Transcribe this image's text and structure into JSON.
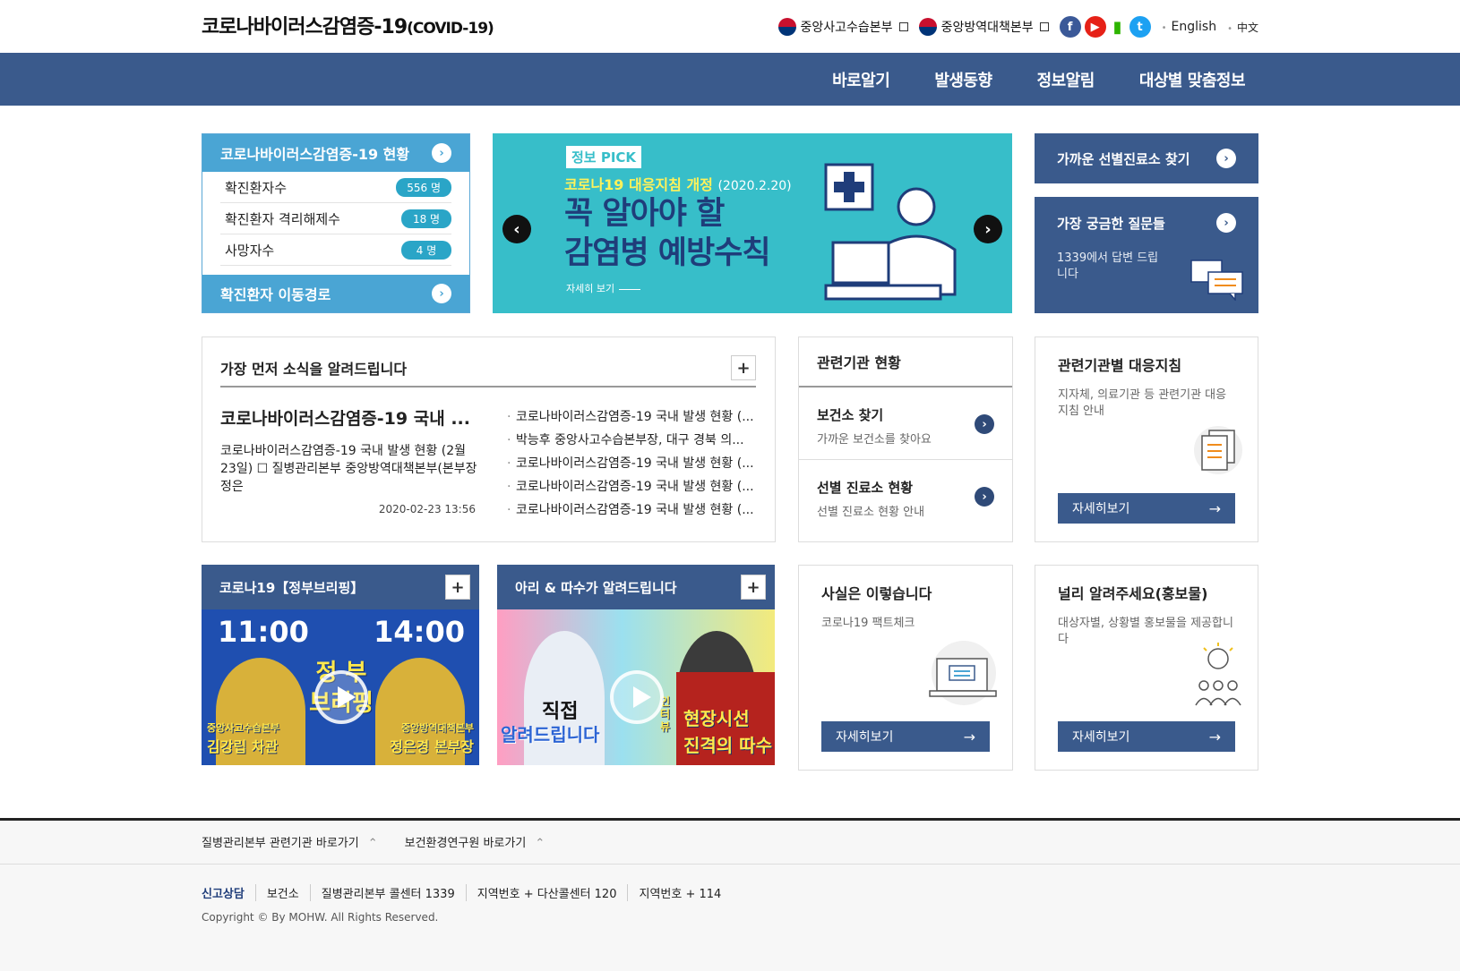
{
  "header": {
    "title_main": "코로나바이러스감염증-19",
    "title_sub": "(COVID-19)",
    "gov_links": [
      "중앙사고수습본부",
      "중앙방역대책본부"
    ],
    "sns": [
      "facebook-icon",
      "youtube-icon",
      "blog-icon",
      "twitter-icon"
    ],
    "languages": [
      "English",
      "中文"
    ]
  },
  "nav": {
    "items": [
      "바로알기",
      "발생동향",
      "정보알림",
      "대상별 맞춤정보"
    ]
  },
  "status": {
    "title": "코로나바이러스감염증-19 현황",
    "rows": [
      {
        "label": "확진환자수",
        "value": "556 명"
      },
      {
        "label": "확진환자 격리해제수",
        "value": "18 명"
      },
      {
        "label": "사망자수",
        "value": "4 명"
      }
    ],
    "route": "확진환자 이동경로"
  },
  "banner": {
    "tag": "정보 PICK",
    "sub": "코로나19 대응지침 개정",
    "date": "(2020.2.20)",
    "title_line1": "꼭 알아야 할",
    "title_line2": "감염병 예방수칙",
    "more": "자세히 보기",
    "prev": "‹",
    "next": "›"
  },
  "clinic": {
    "title": "가까운 선별진료소 찾기"
  },
  "faq": {
    "title": "가장 궁금한 질문들",
    "desc": "1339에서 답변 드립니다"
  },
  "news": {
    "title": "가장 먼저 소식을 알려드립니다",
    "main_title": "코로나바이러스감염증-19 국내 ...",
    "main_body": "코로나바이러스감염증-19 국내 발생 현황 (2월 23일) ☐ 질병관리본부 중앙방역대책본부(본부장 정은",
    "date": "2020-02-23 13:56",
    "list": [
      "코로나바이러스감염증-19 국내 발생 현황 (...",
      "박능후 중앙사고수습본부장, 대구 경북 의...",
      "코로나바이러스감염증-19 국내 발생 현황 (...",
      "코로나바이러스감염증-19 국내 발생 현황 (...",
      "코로나바이러스감염증-19 국내 발생 현황 (..."
    ]
  },
  "agency": {
    "title": "관련기관 현황",
    "rows": [
      {
        "title": "보건소 찾기",
        "desc": "가까운 보건소를 찾아요"
      },
      {
        "title": "선별 진료소 현황",
        "desc": "선별 진료소 현황 안내"
      }
    ]
  },
  "guide": {
    "title": "관련기관별 대응지침",
    "desc": "지자체, 의료기관 등 관련기관 대응 지침 안내",
    "btn": "자세히보기"
  },
  "brief": {
    "title": "코로나19【정부브리핑】",
    "time_left": "11:00",
    "time_right": "14:00",
    "center_text": "정 부 브리핑",
    "left_org": "중앙사고수습본부",
    "left_name": "김강립 차관",
    "right_org": "중앙방역대책본부",
    "right_name": "정은경 본부장"
  },
  "ari": {
    "title": "아리 & 따수가 알려드립니다",
    "left_text1": "직접",
    "left_text2": "알려드립니다",
    "right_text1": "현장시선",
    "right_text2": "진격의 따수",
    "right_tag": "인터뷰"
  },
  "fact": {
    "title": "사실은 이렇습니다",
    "desc": "코로나19 팩트체크",
    "btn": "자세히보기"
  },
  "promo": {
    "title": "널리 알려주세요(홍보물)",
    "desc": "대상자별, 상황별 홍보물을 제공합니다",
    "btn": "자세히보기"
  },
  "footer": {
    "links": [
      "질병관리본부 관련기관 바로가기",
      "보건환경연구원 바로가기"
    ],
    "contact": [
      "신고상담",
      "보건소",
      "질병관리본부 콜센터 1339",
      "지역번호 + 다산콜센터 120",
      "지역번호 + 114"
    ],
    "copyright": "Copyright © By MOHW. All Rights Reserved."
  },
  "colors": {
    "navy": "#3a5a8c",
    "sky": "#4aa5d4",
    "teal": "#37bec9"
  }
}
